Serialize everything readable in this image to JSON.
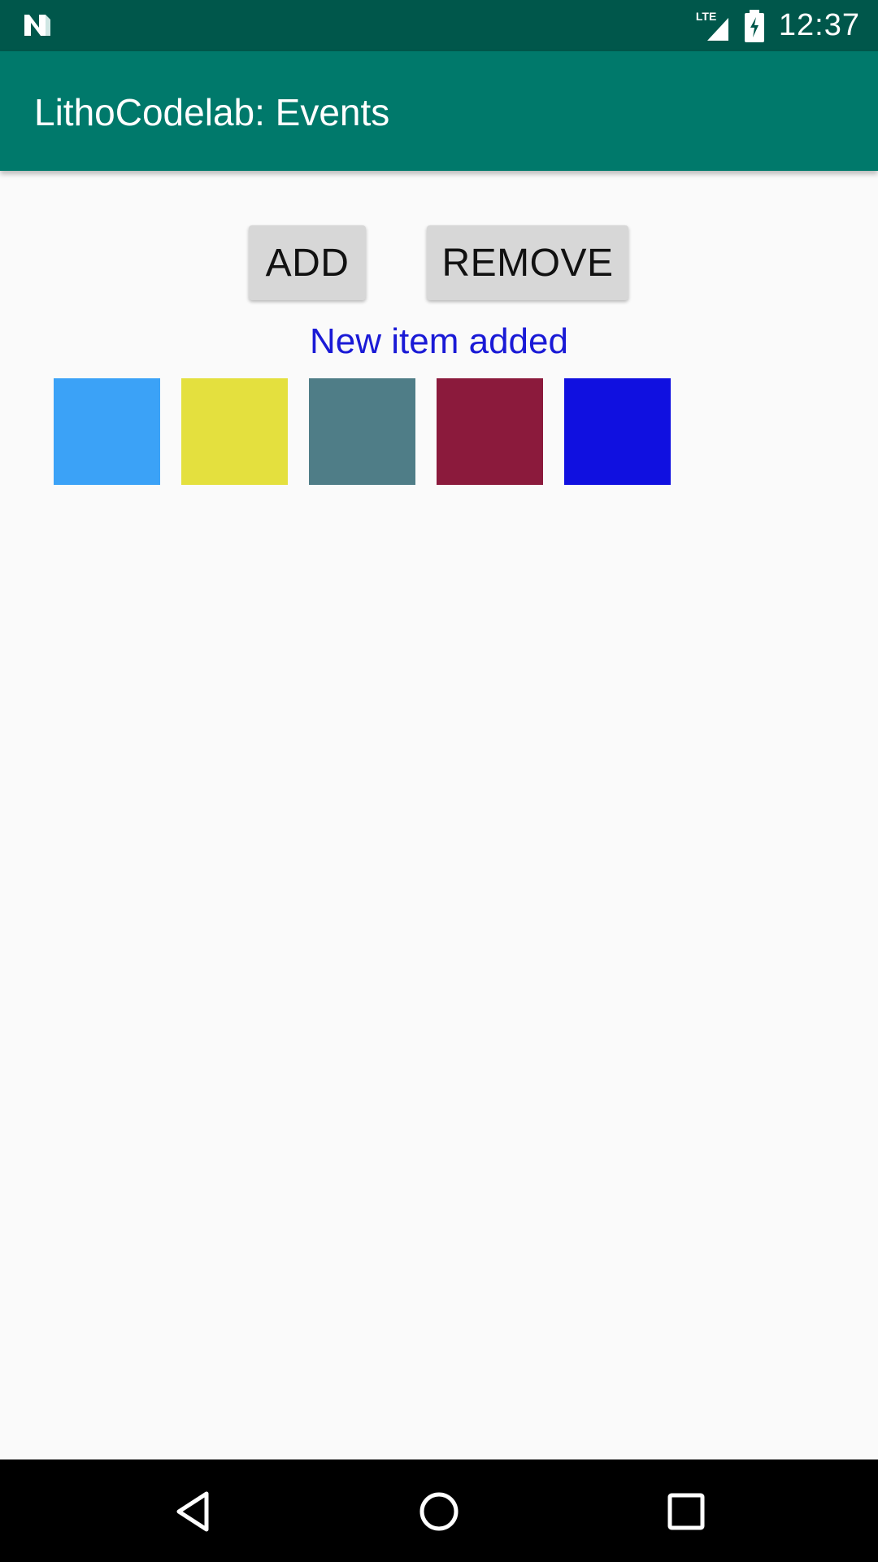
{
  "status_bar": {
    "network_label": "LTE",
    "time": "12:37"
  },
  "app_bar": {
    "title": "LithoCodelab: Events"
  },
  "actions": {
    "add_label": "ADD",
    "remove_label": "REMOVE"
  },
  "message": "New item added",
  "swatches": [
    {
      "color": "#3ba2f7"
    },
    {
      "color": "#e4e03e"
    },
    {
      "color": "#4f7d87"
    },
    {
      "color": "#8b1a3c"
    },
    {
      "color": "#1010e0"
    }
  ],
  "icons": {
    "status_logo": "n-notification-icon",
    "signal": "cell-signal-icon",
    "battery": "battery-charging-icon",
    "back": "back-triangle-icon",
    "home": "home-circle-icon",
    "recents": "recents-square-icon"
  }
}
